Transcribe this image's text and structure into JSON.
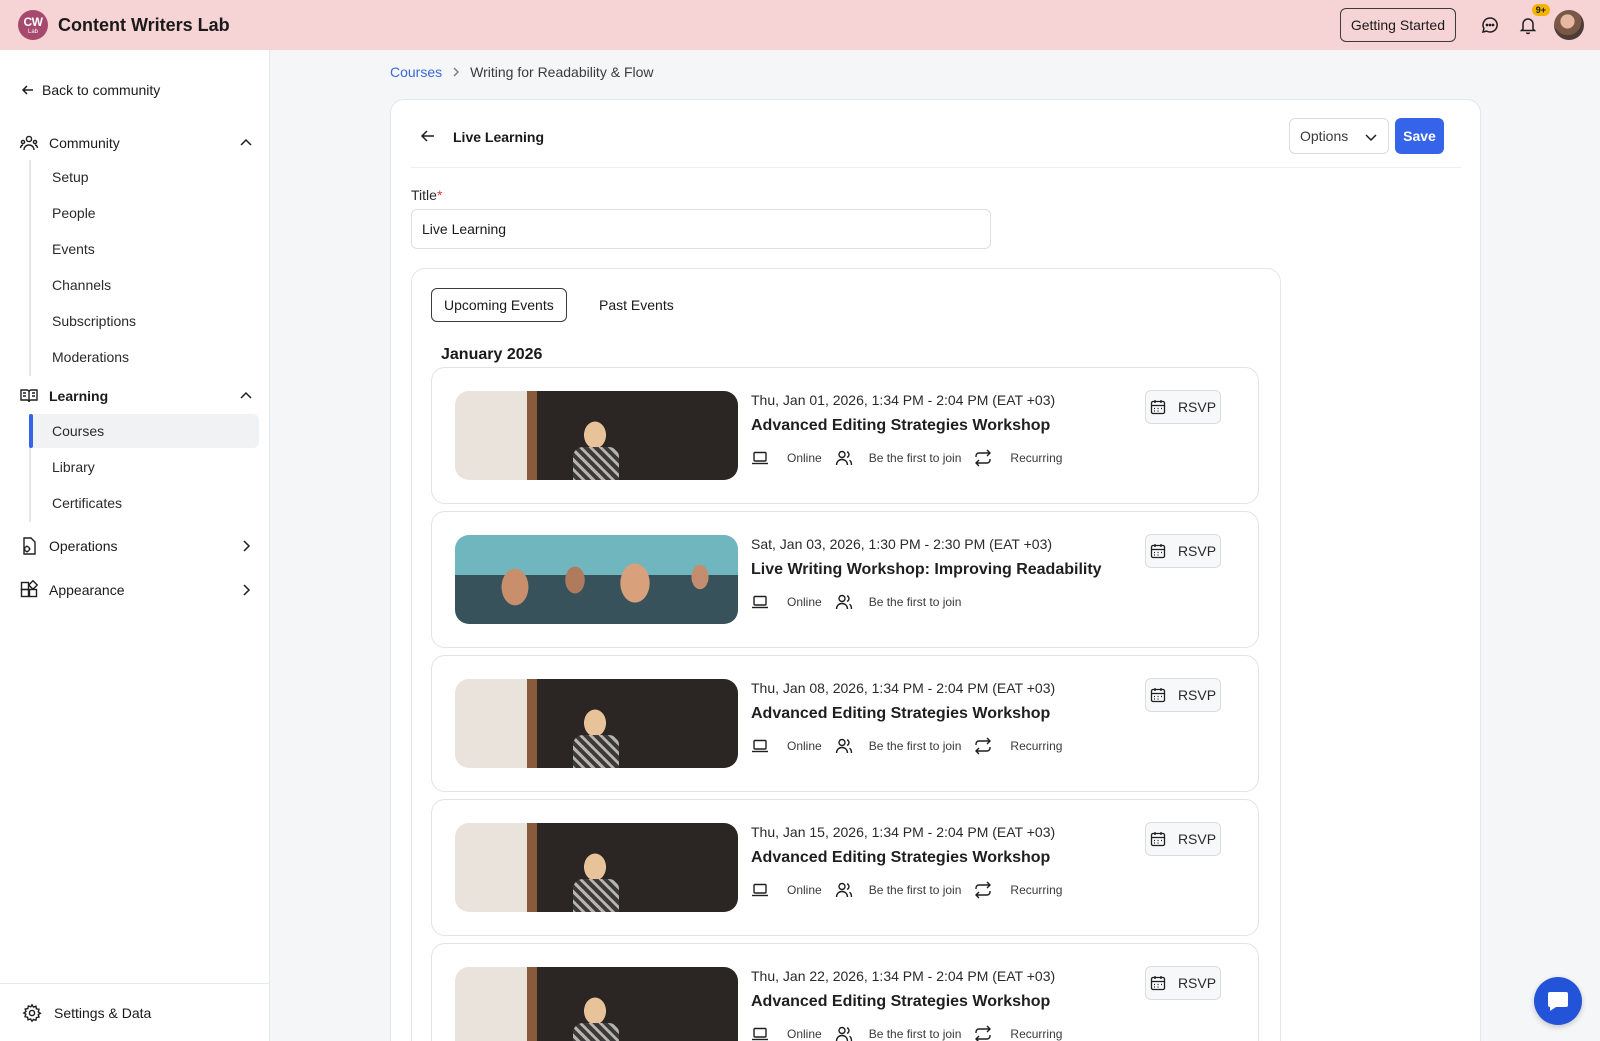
{
  "app": {
    "logo_line1": "CW",
    "logo_line2": "Lab",
    "title": "Content Writers Lab"
  },
  "topbar": {
    "getting_started_label": "Getting Started",
    "notifications_badge": "9+"
  },
  "sidebar": {
    "back_label": "Back to community",
    "community": {
      "label": "Community",
      "items": [
        "Setup",
        "People",
        "Events",
        "Channels",
        "Subscriptions",
        "Moderations"
      ]
    },
    "learning": {
      "label": "Learning",
      "items": [
        "Courses",
        "Library",
        "Certificates"
      ],
      "active_item": "Courses"
    },
    "operations_label": "Operations",
    "appearance_label": "Appearance",
    "settings_label": "Settings & Data"
  },
  "breadcrumb": {
    "parent": "Courses",
    "current": "Writing for Readability & Flow"
  },
  "editor": {
    "header_title": "Live Learning",
    "options_label": "Options",
    "save_label": "Save",
    "title_label": "Title",
    "title_required_mark": "*",
    "title_value": "Live Learning"
  },
  "events": {
    "tabs": [
      "Upcoming Events",
      "Past Events"
    ],
    "active_tab": "Upcoming Events",
    "month": "January 2026",
    "rsvp_label": "RSVP",
    "items": [
      {
        "date": "Thu, Jan 01, 2026, 1:34 PM - 2:04 PM (EAT +03)",
        "title": "Advanced Editing Strategies Workshop",
        "location": "Online",
        "attendance": "Be the first to join",
        "recurrence": "Recurring",
        "image": "speaker"
      },
      {
        "date": "Sat, Jan 03, 2026, 1:30 PM - 2:30 PM (EAT +03)",
        "title": "Live Writing Workshop: Improving Readability",
        "location": "Online",
        "attendance": "Be the first to join",
        "recurrence": null,
        "image": "crowd"
      },
      {
        "date": "Thu, Jan 08, 2026, 1:34 PM - 2:04 PM (EAT +03)",
        "title": "Advanced Editing Strategies Workshop",
        "location": "Online",
        "attendance": "Be the first to join",
        "recurrence": "Recurring",
        "image": "speaker"
      },
      {
        "date": "Thu, Jan 15, 2026, 1:34 PM - 2:04 PM (EAT +03)",
        "title": "Advanced Editing Strategies Workshop",
        "location": "Online",
        "attendance": "Be the first to join",
        "recurrence": "Recurring",
        "image": "speaker"
      },
      {
        "date": "Thu, Jan 22, 2026, 1:34 PM - 2:04 PM (EAT +03)",
        "title": "Advanced Editing Strategies Workshop",
        "location": "Online",
        "attendance": "Be the first to join",
        "recurrence": "Recurring",
        "image": "speaker"
      }
    ]
  },
  "colors": {
    "topbar_bg": "#f6d3d5",
    "accent": "#3563e9",
    "link": "#3a68d8",
    "badge": "#f5b400"
  },
  "icons": {
    "chat": "chat-bubble-icon",
    "notifications": "bell-icon",
    "settings": "gear-icon",
    "support": "support-chat-icon"
  }
}
